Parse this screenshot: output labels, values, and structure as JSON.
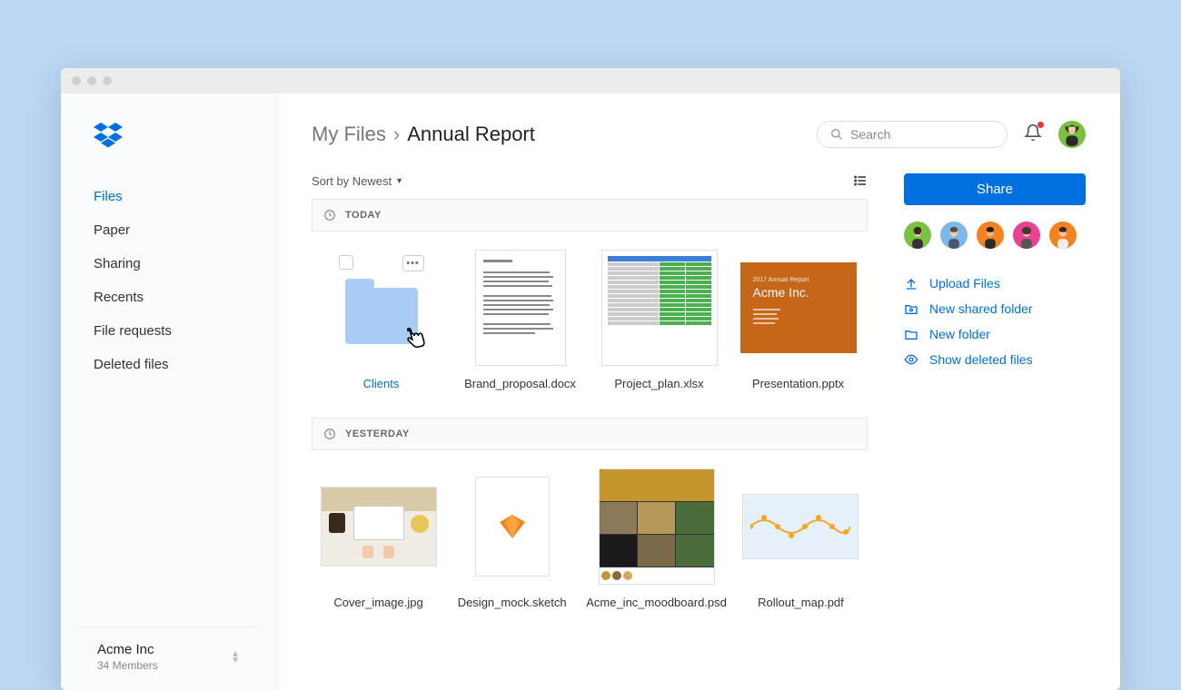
{
  "sidebar": {
    "nav": [
      {
        "label": "Files",
        "active": true
      },
      {
        "label": "Paper"
      },
      {
        "label": "Sharing"
      },
      {
        "label": "Recents"
      },
      {
        "label": "File requests"
      },
      {
        "label": "Deleted files"
      }
    ],
    "team": {
      "name": "Acme Inc",
      "members": "34 Members"
    }
  },
  "header": {
    "breadcrumbs": {
      "root": "My Files",
      "current": "Annual Report"
    },
    "search_placeholder": "Search"
  },
  "sort": {
    "label": "Sort by Newest"
  },
  "sections": {
    "today": {
      "label": "TODAY",
      "items": [
        {
          "name": "Clients",
          "type": "folder",
          "selected": true
        },
        {
          "name": "Brand_proposal.docx",
          "type": "doc"
        },
        {
          "name": "Project_plan.xlsx",
          "type": "xls"
        },
        {
          "name": "Presentation.pptx",
          "type": "ppt",
          "slide_title_small": "2017 Annual Report",
          "slide_title": "Acme Inc."
        }
      ]
    },
    "yesterday": {
      "label": "YESTERDAY",
      "items": [
        {
          "name": "Cover_image.jpg",
          "type": "img"
        },
        {
          "name": "Design_mock.sketch",
          "type": "sketch"
        },
        {
          "name": "Acme_inc_moodboard.psd",
          "type": "mood"
        },
        {
          "name": "Rollout_map.pdf",
          "type": "map"
        }
      ]
    }
  },
  "right": {
    "share": "Share",
    "avatars": [
      "#7ac142",
      "#7cb8e8",
      "#f58220",
      "#e84393",
      "#f58220"
    ],
    "actions": [
      {
        "icon": "upload",
        "label": "Upload Files"
      },
      {
        "icon": "shared-folder",
        "label": "New shared folder"
      },
      {
        "icon": "folder",
        "label": "New folder"
      },
      {
        "icon": "eye",
        "label": "Show deleted files"
      }
    ]
  }
}
